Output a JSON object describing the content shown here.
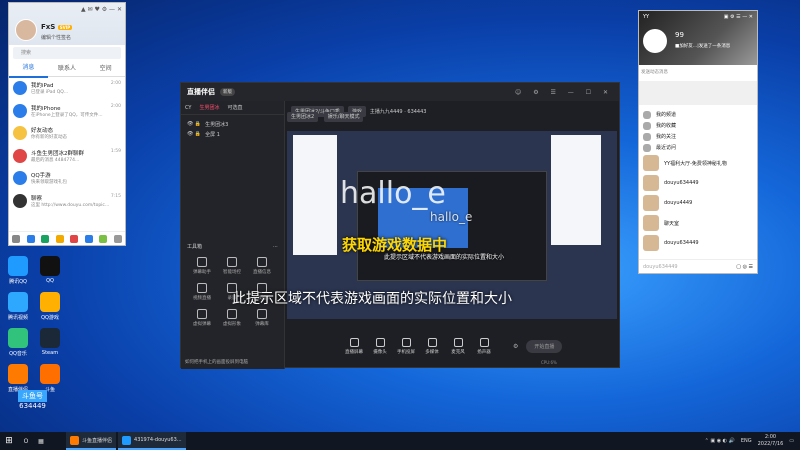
{
  "qq": {
    "nick": "FxS",
    "vip_badge": "SVIP",
    "signature": "编辑个性签名",
    "search_placeholder": "搜索",
    "tabs": [
      "消息",
      "联系人",
      "空间"
    ],
    "items": [
      {
        "title": "我的iPad",
        "sub": "已登录 iPad QQ...",
        "time": "2:00",
        "color": "#2b7de9"
      },
      {
        "title": "我的iPhone",
        "sub": "在iPhone上登录了QQ，可传文件...",
        "time": "2:00",
        "color": "#2b7de9"
      },
      {
        "title": "好友动态",
        "sub": "你有新的好友动态",
        "time": "",
        "color": "#f6c242"
      },
      {
        "title": "斗鱼生男团冰2群聊群",
        "sub": "最后的消息 4484774...",
        "time": "1:59",
        "color": "#e04646"
      },
      {
        "title": "QQ手游",
        "sub": "快来领取游戏礼包",
        "time": "",
        "color": "#2b7de9"
      },
      {
        "title": "聊察",
        "sub": "这里 http://www.douyu.com/topic...",
        "time": "7:15",
        "color": "#333"
      }
    ]
  },
  "desktop_icons": [
    {
      "label": "腾讯QQ",
      "color": "#1f9bff"
    },
    {
      "label": "QQ",
      "color": "#111"
    },
    {
      "label": "腾讯视频",
      "color": "#2ea7ff"
    },
    {
      "label": "QQ游戏",
      "color": "#ffb000"
    },
    {
      "label": "QQ音乐",
      "color": "#31c27c"
    },
    {
      "label": "Steam",
      "color": "#1b2838"
    },
    {
      "label": "直播伴侣",
      "color": "#ff7a00"
    },
    {
      "label": "斗鱼",
      "color": "#ff6f00"
    }
  ],
  "live": {
    "logo": "直播伴侣",
    "version": "新版",
    "left_tabs": [
      "CY",
      "生男团冰",
      "可选直"
    ],
    "scenes": [
      "生男团冰3",
      "全屏 1"
    ],
    "tools_title": "工具箱",
    "tools": [
      {
        "label": "弹幕助手"
      },
      {
        "label": "智能场控"
      },
      {
        "label": "直播信息"
      },
      {
        "label": "视频直播"
      },
      {
        "label": "录屏"
      },
      {
        "label": "游戏推荐"
      },
      {
        "label": "虚拟弹幕"
      },
      {
        "label": "虚拟形象"
      },
      {
        "label": "弹幕库"
      }
    ],
    "tip": "如何把手机上的画面投屏到电脑",
    "chips": [
      "生男团冰2/斗鱼口秀",
      "游戏"
    ],
    "stats": "主播九九4449 · 634443",
    "chips2": [
      "生男团冰2",
      "娱乐/聊天模式"
    ],
    "bottom_buttons": [
      "直播屏幕",
      "摄像头",
      "手机投屏",
      "多媒体",
      "麦克风",
      "扬声器"
    ],
    "start_label": "开始直播",
    "status": "CPU:6%"
  },
  "overlay": {
    "watermark": "hallo_e",
    "watermark_small": "hallo_e",
    "yellow_text": "获取游戏数据中",
    "white_text": "此提示区域不代表游戏画面的实际位置和大小",
    "white_small": "此提示区域不代表游戏画面的实际位置和大小"
  },
  "qq_chat": {
    "name": "YY",
    "nick": "99",
    "status_text": "■加好友…|发送了一条消息",
    "input_placeholder": "发送动态消息",
    "items": [
      {
        "t": "我的频道"
      },
      {
        "t": "我的收藏"
      },
      {
        "t": "我的关注"
      },
      {
        "t": "最近访问"
      },
      {
        "t": "YY福利大厅-免费领神秘礼物"
      },
      {
        "t": "douyu634449"
      },
      {
        "t": "douyu4449"
      },
      {
        "t": "聊天室"
      },
      {
        "t": "douyu634449"
      }
    ]
  },
  "taskbar": {
    "search_hint": "O",
    "tasks": [
      {
        "label": "斗鱼直播伴侣",
        "color": "#ff7a00"
      },
      {
        "label": "431974-douyu63...",
        "color": "#1f9bff"
      }
    ],
    "lang": "ENG",
    "time": "2:00",
    "date": "2022/7/16"
  },
  "overlay_id": {
    "room": "634449",
    "label": "斗鱼号"
  }
}
